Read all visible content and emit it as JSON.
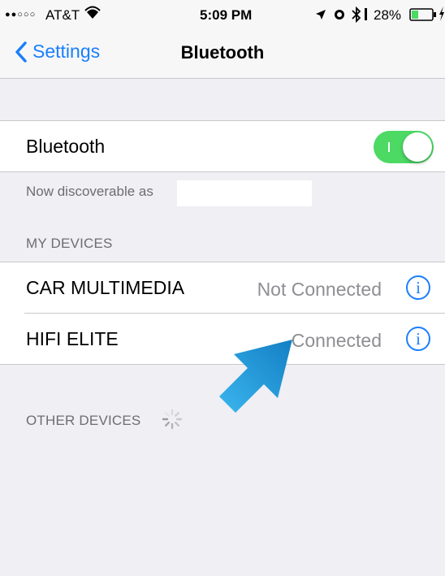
{
  "status_bar": {
    "carrier": "AT&T",
    "time": "5:09 PM",
    "battery": "28%"
  },
  "nav": {
    "back_label": "Settings",
    "title": "Bluetooth"
  },
  "bluetooth_row": {
    "label": "Bluetooth",
    "toggle_on": true
  },
  "discoverable_text": "Now discoverable as",
  "my_devices": {
    "header": "MY DEVICES",
    "items": [
      {
        "name": "CAR MULTIMEDIA",
        "status": "Not Connected"
      },
      {
        "name": "HIFI ELITE",
        "status": "Connected"
      }
    ]
  },
  "other_devices": {
    "header": "OTHER DEVICES"
  },
  "colors": {
    "accent": "#1a7ffb",
    "toggle_on": "#4cd964",
    "arrow": "#1e9fe0"
  },
  "icons": [
    "signal-dots-icon",
    "wifi-icon",
    "location-icon",
    "alarm-icon",
    "bluetooth-icon",
    "battery-icon",
    "charging-icon",
    "back-chevron-icon",
    "info-icon",
    "spinner-icon",
    "arrow-annotation-icon"
  ]
}
